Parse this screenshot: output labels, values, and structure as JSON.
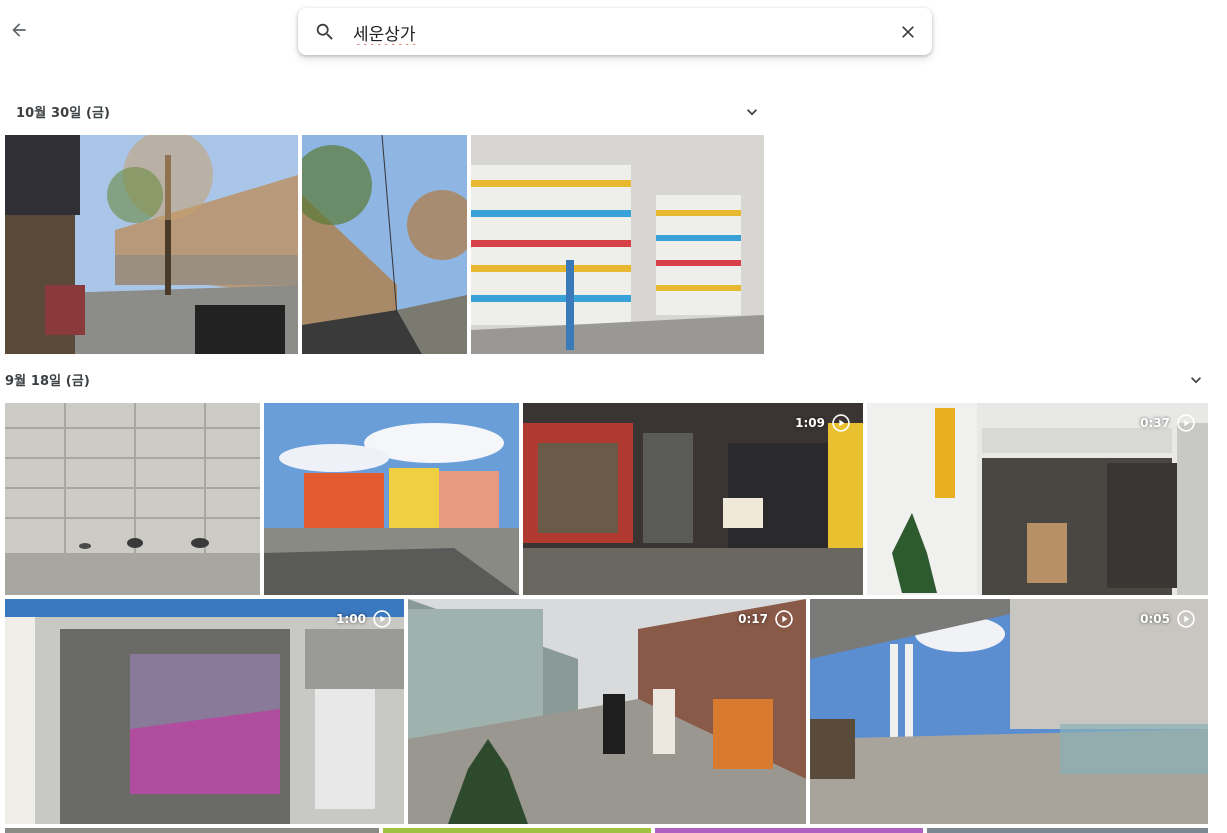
{
  "search": {
    "query": "세운상가",
    "placeholder": ""
  },
  "icons": {
    "back": "arrow-left-icon",
    "search": "search-icon",
    "clear": "close-icon",
    "collapse": "chevron-down-icon",
    "video": "play-circle-icon"
  },
  "colors": {
    "text": "#202124",
    "accent": "#1a73e8"
  },
  "sections": [
    {
      "date": "10월 30일 (금)",
      "photos": [
        {
          "kind": "photo",
          "subject": "stone wall street"
        },
        {
          "kind": "photo",
          "subject": "alley with trees"
        },
        {
          "kind": "photo",
          "subject": "striped shutters"
        }
      ]
    },
    {
      "date": "9월 18일 (금)",
      "photos": [
        {
          "kind": "photo",
          "subject": "stone wall with pigeons"
        },
        {
          "kind": "photo",
          "subject": "colorful rooftops"
        },
        {
          "kind": "video",
          "duration": "1:09",
          "subject": "shop front"
        },
        {
          "kind": "video",
          "duration": "0:37",
          "subject": "happy club entrance"
        },
        {
          "kind": "video",
          "duration": "1:00",
          "subject": "neon studio window"
        },
        {
          "kind": "video",
          "duration": "0:17",
          "subject": "market walkway"
        },
        {
          "kind": "video",
          "duration": "0:05",
          "subject": "elevated deck"
        }
      ]
    }
  ]
}
